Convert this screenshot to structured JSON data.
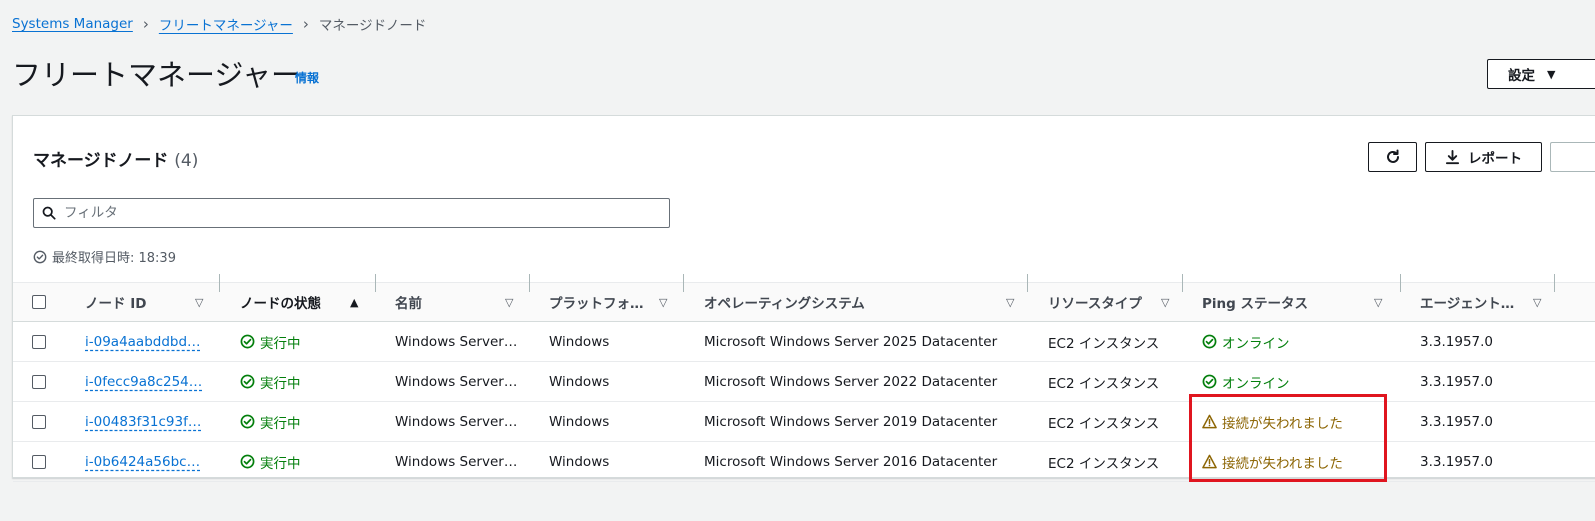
{
  "breadcrumb": {
    "items": [
      "Systems Manager",
      "フリートマネージャー"
    ],
    "current": "マネージドノード"
  },
  "page": {
    "title": "フリートマネージャー",
    "info": "情報",
    "settings_label": "設定"
  },
  "panel": {
    "title": "マネージドノード",
    "count": "(4)",
    "report_label": "レポート",
    "filter_placeholder": "フィルタ",
    "last_updated": "最終取得日時: 18:39"
  },
  "table": {
    "columns": [
      "ノード ID",
      "ノードの状態",
      "名前",
      "プラットフォ…",
      "オペレーティングシステム",
      "リソースタイプ",
      "Ping ステータス",
      "エージェント…"
    ],
    "rows": [
      {
        "node_id": "i-09a4aabddbd…",
        "state": "実行中",
        "name": "Windows Server…",
        "platform": "Windows",
        "os": "Microsoft Windows Server 2025 Datacenter",
        "resource_type": "EC2 インスタンス",
        "ping": "オンライン",
        "ping_status": "ok",
        "agent": "3.3.1957.0"
      },
      {
        "node_id": "i-0fecc9a8c254…",
        "state": "実行中",
        "name": "Windows Server…",
        "platform": "Windows",
        "os": "Microsoft Windows Server 2022 Datacenter",
        "resource_type": "EC2 インスタンス",
        "ping": "オンライン",
        "ping_status": "ok",
        "agent": "3.3.1957.0"
      },
      {
        "node_id": "i-00483f31c93f…",
        "state": "実行中",
        "name": "Windows Server…",
        "platform": "Windows",
        "os": "Microsoft Windows Server 2019 Datacenter",
        "resource_type": "EC2 インスタンス",
        "ping": "接続が失われました",
        "ping_status": "warning",
        "agent": "3.3.1957.0"
      },
      {
        "node_id": "i-0b6424a56bc…",
        "state": "実行中",
        "name": "Windows Server…",
        "platform": "Windows",
        "os": "Microsoft Windows Server 2016 Datacenter",
        "resource_type": "EC2 インスタンス",
        "ping": "接続が失われました",
        "ping_status": "warning",
        "agent": "3.3.1957.0"
      }
    ]
  },
  "colors": {
    "link": "#0972d3",
    "success": "#037f0c",
    "warning": "#8d6605",
    "highlight": "#e0151f"
  },
  "icons": {
    "refresh": "refresh-icon",
    "download": "download-icon",
    "search": "search-icon",
    "status_ok": "status-positive-icon",
    "status_warning": "status-warning-icon",
    "clock": "status-pending-icon"
  }
}
